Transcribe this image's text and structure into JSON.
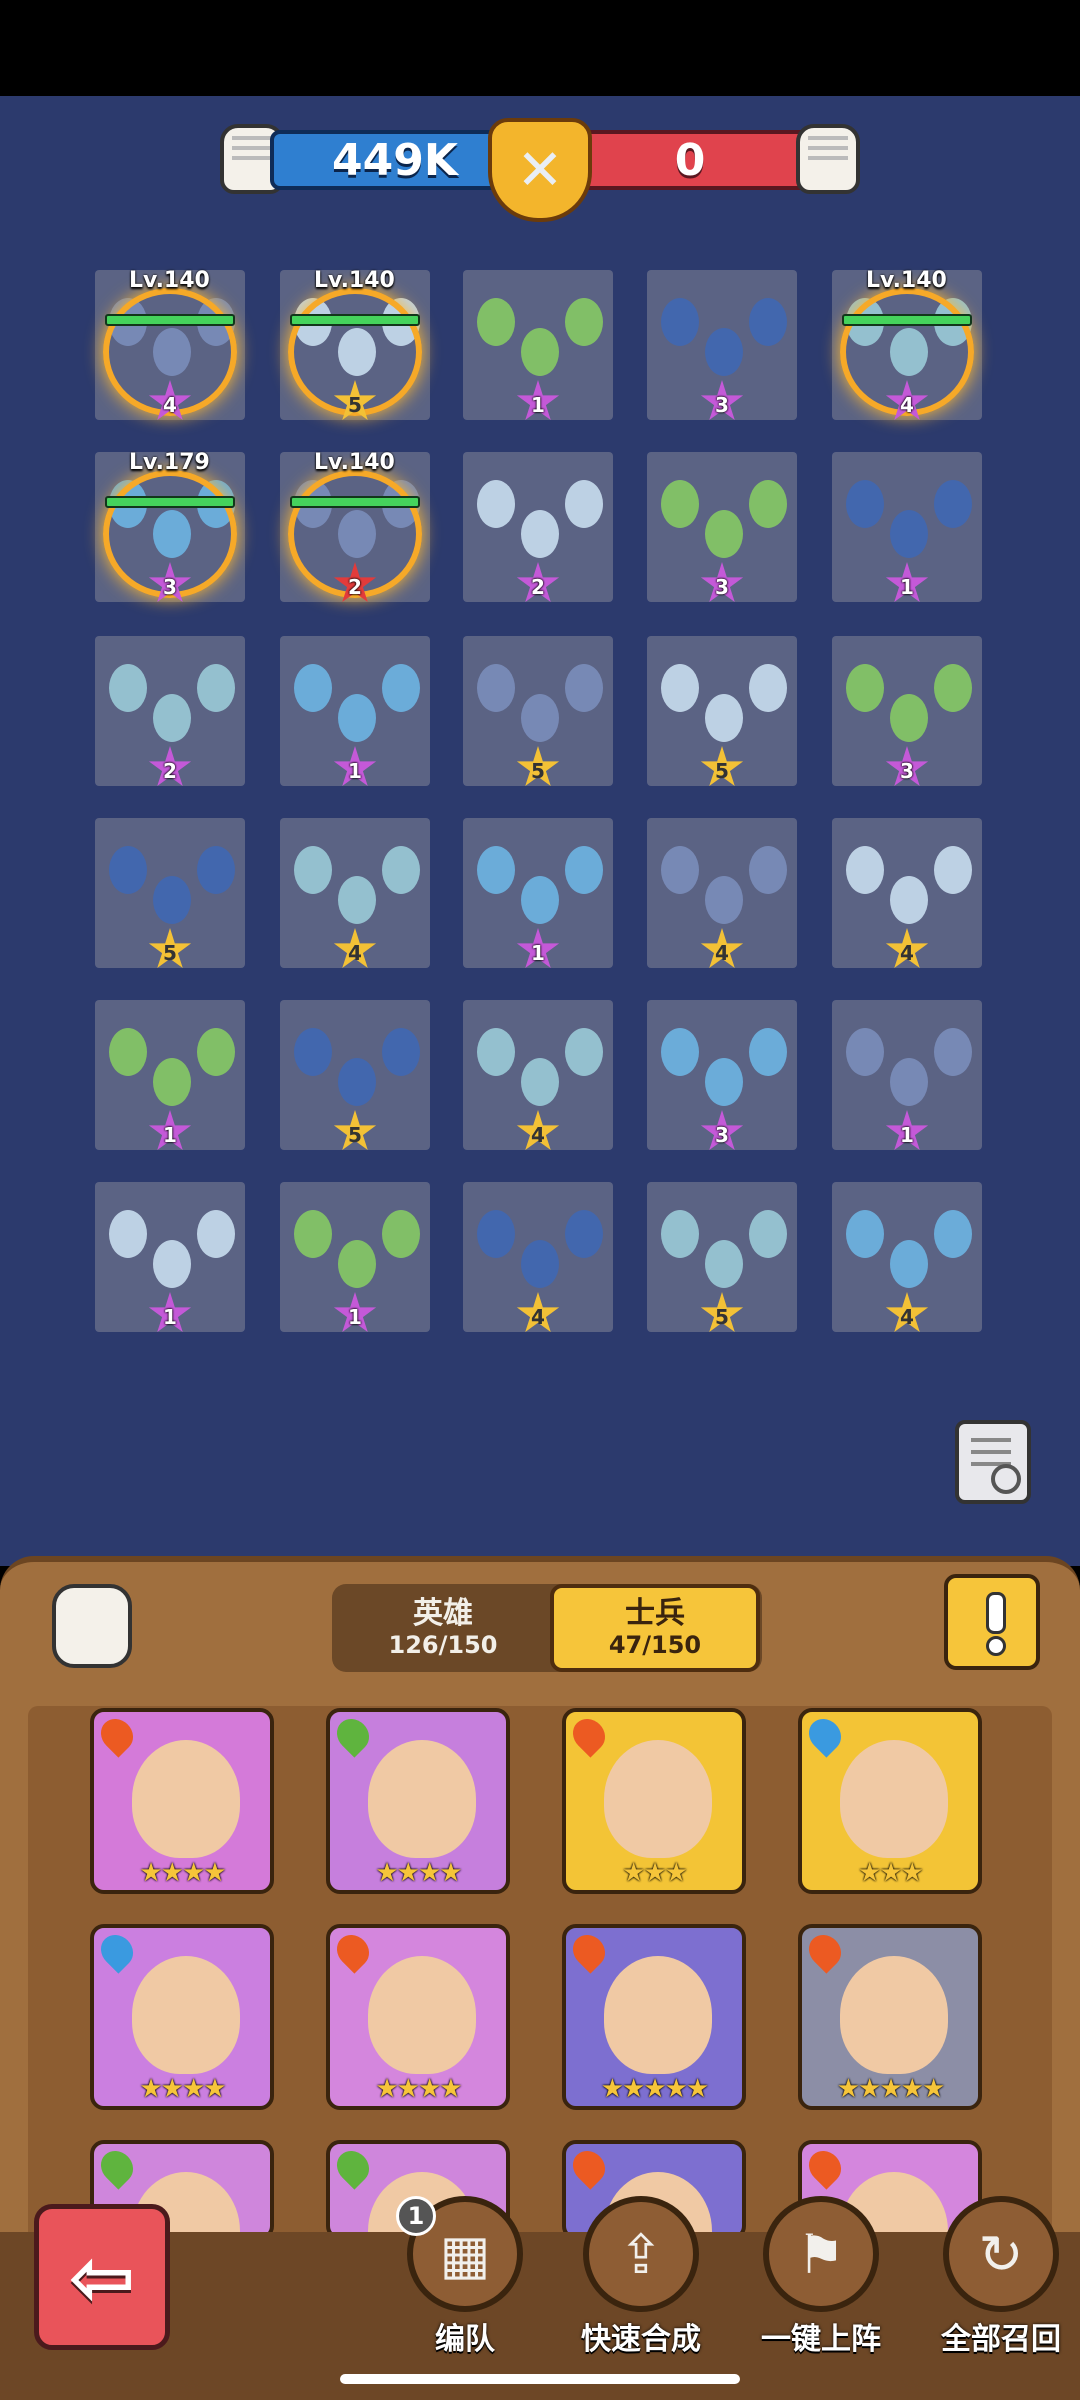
{
  "battle": {
    "my_power": "449K",
    "enemy_power": "0"
  },
  "grid": {
    "tiles": [
      {
        "star": "4",
        "star_color": "purple",
        "level": "Lv.140"
      },
      {
        "star": "5",
        "star_color": "gold",
        "level": "Lv.140"
      },
      {
        "star": "1",
        "star_color": "purple"
      },
      {
        "star": "3",
        "star_color": "purple"
      },
      {
        "star": "4",
        "star_color": "purple",
        "level": "Lv.140"
      },
      {
        "star": "3",
        "star_color": "purple",
        "level": "Lv.179"
      },
      {
        "star": "2",
        "star_color": "red",
        "level": "Lv.140"
      },
      {
        "star": "2",
        "star_color": "purple"
      },
      {
        "star": "3",
        "star_color": "purple"
      },
      {
        "star": "1",
        "star_color": "purple"
      },
      {
        "star": "2",
        "star_color": "purple"
      },
      {
        "star": "1",
        "star_color": "purple"
      },
      {
        "star": "5",
        "star_color": "gold"
      },
      {
        "star": "5",
        "star_color": "gold"
      },
      {
        "star": "3",
        "star_color": "purple"
      },
      {
        "star": "5",
        "star_color": "gold"
      },
      {
        "star": "4",
        "star_color": "gold"
      },
      {
        "star": "1",
        "star_color": "purple"
      },
      {
        "star": "4",
        "star_color": "gold"
      },
      {
        "star": "4",
        "star_color": "gold"
      },
      {
        "star": "1",
        "star_color": "purple"
      },
      {
        "star": "5",
        "star_color": "gold"
      },
      {
        "star": "4",
        "star_color": "gold"
      },
      {
        "star": "3",
        "star_color": "purple"
      },
      {
        "star": "1",
        "star_color": "purple"
      },
      {
        "star": "1",
        "star_color": "purple"
      },
      {
        "star": "1",
        "star_color": "purple"
      },
      {
        "star": "4",
        "star_color": "gold"
      },
      {
        "star": "5",
        "star_color": "gold"
      },
      {
        "star": "4",
        "star_color": "gold"
      }
    ]
  },
  "tabs": {
    "hero": {
      "label": "英雄",
      "count": "126/150"
    },
    "soldier": {
      "label": "士兵",
      "count": "47/150"
    }
  },
  "cards": [
    {
      "element": "fire",
      "stars": "★★★★",
      "bg": "#d47ad9"
    },
    {
      "element": "leaf",
      "stars": "★★★★",
      "bg": "#c67fdd"
    },
    {
      "element": "fire",
      "stars": "★★★",
      "bg": "#f3c436"
    },
    {
      "element": "water",
      "stars": "★★★",
      "bg": "#f3c436"
    },
    {
      "element": "water",
      "stars": "★★★★",
      "bg": "#cb7fe0"
    },
    {
      "element": "fire",
      "stars": "★★★★",
      "bg": "#d486dd"
    },
    {
      "element": "fire",
      "stars": "★★★★★",
      "bg": "#7d6fd0"
    },
    {
      "element": "fire",
      "stars": "★★★★★",
      "bg": "#8c8ea6"
    },
    {
      "element": "leaf",
      "stars": "",
      "bg": "#cf86dc"
    },
    {
      "element": "leaf",
      "stars": "",
      "bg": "#cf86dc"
    },
    {
      "element": "fire",
      "stars": "",
      "bg": "#7d6fd0"
    },
    {
      "element": "fire",
      "stars": "",
      "bg": "#d486dd"
    }
  ],
  "actions": {
    "formation": {
      "label": "编队",
      "badge": "1"
    },
    "quick_merge": {
      "label": "快速合成"
    },
    "deploy_all": {
      "label": "一键上阵"
    },
    "recall_all": {
      "label": "全部召回"
    }
  },
  "icons": {
    "back": "back-arrow-icon",
    "report": "battle-report-icon",
    "info": "info-icon",
    "power": "fist-icon"
  }
}
